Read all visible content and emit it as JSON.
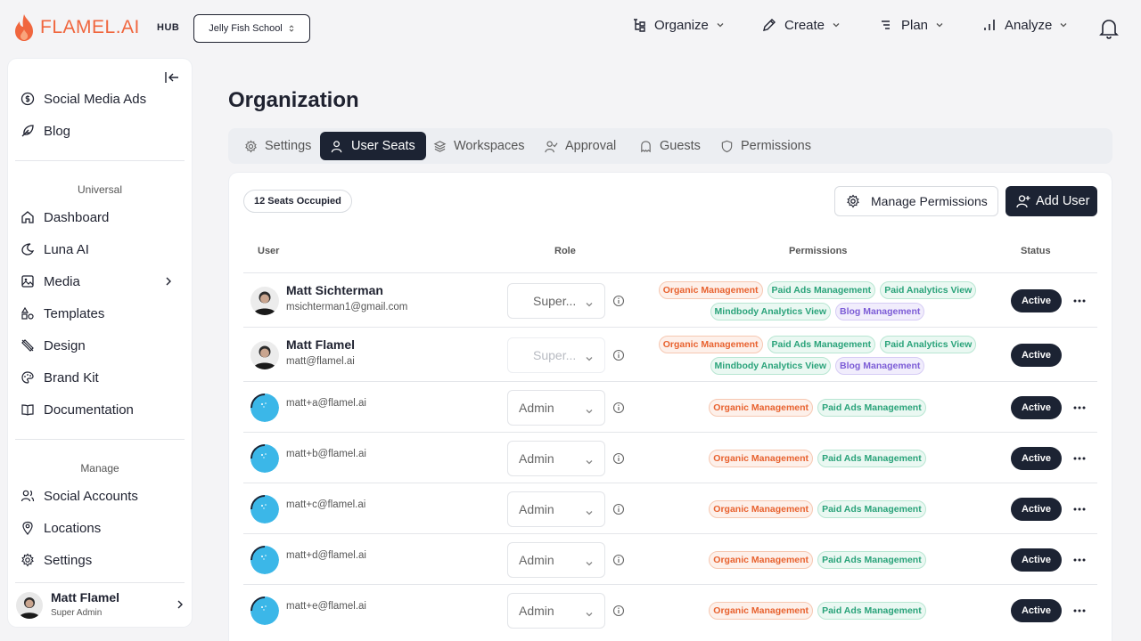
{
  "header": {
    "logo_text": "FLAMEL.AI",
    "hub_label": "HUB",
    "org_selector": "Jelly Fish School",
    "nav": [
      {
        "label": "Organize",
        "icon": "organize-icon"
      },
      {
        "label": "Create",
        "icon": "pen-icon"
      },
      {
        "label": "Plan",
        "icon": "list-icon"
      },
      {
        "label": "Analyze",
        "icon": "bar-chart-icon"
      }
    ]
  },
  "sidebar": {
    "items_top": [
      {
        "label": "Social Media Ads",
        "icon": "dollar-icon"
      },
      {
        "label": "Blog",
        "icon": "feather-icon"
      }
    ],
    "section_universal": "Universal",
    "items_universal": [
      {
        "label": "Dashboard",
        "icon": "home-icon"
      },
      {
        "label": "Luna AI",
        "icon": "moon-icon"
      },
      {
        "label": "Media",
        "icon": "image-icon"
      },
      {
        "label": "Templates",
        "icon": "shapes-icon"
      },
      {
        "label": "Design",
        "icon": "design-icon"
      },
      {
        "label": "Brand Kit",
        "icon": "palette-icon"
      },
      {
        "label": "Documentation",
        "icon": "book-icon"
      }
    ],
    "section_manage": "Manage",
    "items_manage": [
      {
        "label": "Social Accounts",
        "icon": "users-icon"
      },
      {
        "label": "Locations",
        "icon": "pin-icon"
      },
      {
        "label": "Settings",
        "icon": "gear-icon"
      }
    ],
    "profile": {
      "name": "Matt Flamel",
      "role": "Super Admin"
    }
  },
  "main": {
    "title": "Organization",
    "tabs": [
      {
        "label": "Settings",
        "active": false
      },
      {
        "label": "User Seats",
        "active": true
      },
      {
        "label": "Workspaces",
        "active": false
      },
      {
        "label": "Approval",
        "active": false
      },
      {
        "label": "Guests",
        "active": false
      },
      {
        "label": "Permissions",
        "active": false
      }
    ],
    "seats_badge": "12 Seats Occupied",
    "manage_permissions_label": "Manage Permissions",
    "add_user_label": "Add User",
    "columns": {
      "user": "User",
      "role": "Role",
      "permissions": "Permissions",
      "status": "Status"
    },
    "users": [
      {
        "name": "Matt Sichterman",
        "email": "msichterman1@gmail.com",
        "avatar": "photo",
        "role": "Super...",
        "role_disabled": false,
        "permissions": [
          [
            "Organic Management",
            "orange"
          ],
          [
            "Paid Ads Management",
            "green"
          ],
          [
            "Paid Analytics View",
            "green"
          ],
          [
            "Mindbody Analytics View",
            "green"
          ],
          [
            "Blog Management",
            "purple"
          ]
        ],
        "status": "Active",
        "has_menu": true
      },
      {
        "name": "Matt Flamel",
        "email": "matt@flamel.ai",
        "avatar": "photo",
        "role": "Super...",
        "role_disabled": true,
        "permissions": [
          [
            "Organic Management",
            "orange"
          ],
          [
            "Paid Ads Management",
            "green"
          ],
          [
            "Paid Analytics View",
            "green"
          ],
          [
            "Mindbody Analytics View",
            "green"
          ],
          [
            "Blog Management",
            "purple"
          ]
        ],
        "status": "Active",
        "has_menu": false
      },
      {
        "name": "",
        "email": "matt+a@flamel.ai",
        "avatar": "default",
        "role": "Admin",
        "role_disabled": false,
        "permissions": [
          [
            "Organic Management",
            "orange"
          ],
          [
            "Paid Ads Management",
            "green"
          ]
        ],
        "status": "Active",
        "has_menu": true
      },
      {
        "name": "",
        "email": "matt+b@flamel.ai",
        "avatar": "default",
        "role": "Admin",
        "role_disabled": false,
        "permissions": [
          [
            "Organic Management",
            "orange"
          ],
          [
            "Paid Ads Management",
            "green"
          ]
        ],
        "status": "Active",
        "has_menu": true
      },
      {
        "name": "",
        "email": "matt+c@flamel.ai",
        "avatar": "default",
        "role": "Admin",
        "role_disabled": false,
        "permissions": [
          [
            "Organic Management",
            "orange"
          ],
          [
            "Paid Ads Management",
            "green"
          ]
        ],
        "status": "Active",
        "has_menu": true
      },
      {
        "name": "",
        "email": "matt+d@flamel.ai",
        "avatar": "default",
        "role": "Admin",
        "role_disabled": false,
        "permissions": [
          [
            "Organic Management",
            "orange"
          ],
          [
            "Paid Ads Management",
            "green"
          ]
        ],
        "status": "Active",
        "has_menu": true
      },
      {
        "name": "",
        "email": "matt+e@flamel.ai",
        "avatar": "default",
        "role": "Admin",
        "role_disabled": false,
        "permissions": [
          [
            "Organic Management",
            "orange"
          ],
          [
            "Paid Ads Management",
            "green"
          ]
        ],
        "status": "Active",
        "has_menu": true
      }
    ]
  },
  "colors": {
    "brand": "#f0663e",
    "dark": "#1c2333",
    "orange": "#e8622f",
    "green": "#2aa37a",
    "purple": "#7c5cd6",
    "avatar_blue": "#3bb7e8"
  }
}
